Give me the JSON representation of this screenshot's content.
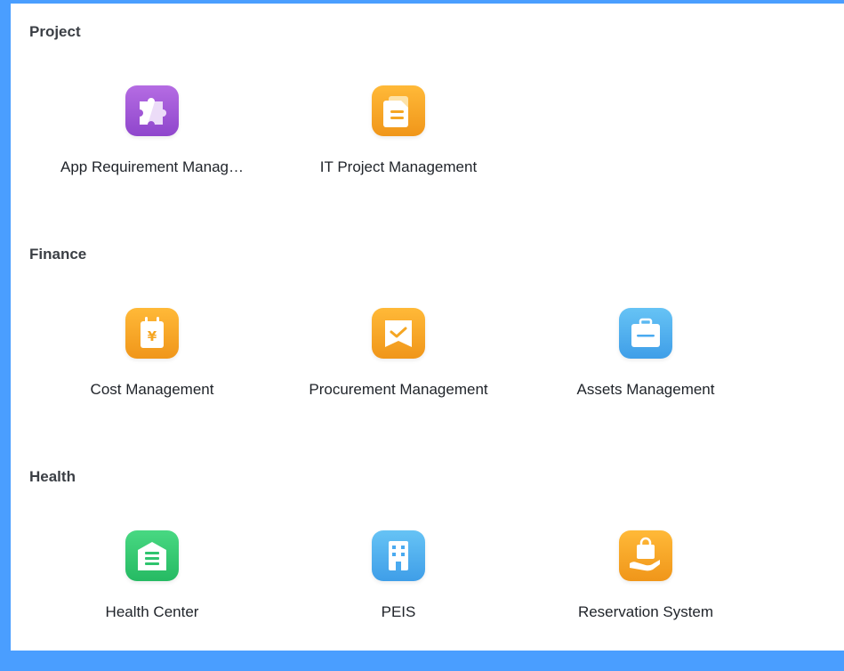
{
  "sections": [
    {
      "title": "Project",
      "apps": [
        {
          "label": "App Requirement Manag…",
          "icon": "puzzle-icon",
          "color": "#9b55d6"
        },
        {
          "label": "IT Project Management",
          "icon": "document-icon",
          "color": "#f5a623"
        }
      ]
    },
    {
      "title": "Finance",
      "apps": [
        {
          "label": "Cost Management",
          "icon": "yen-bag-icon",
          "color": "#f5a623"
        },
        {
          "label": "Procurement Management",
          "icon": "checked-envelope-icon",
          "color": "#f5a623"
        },
        {
          "label": "Assets Management",
          "icon": "briefcase-icon",
          "color": "#4aaaf0"
        }
      ]
    },
    {
      "title": "Health",
      "apps": [
        {
          "label": "Health Center",
          "icon": "building-list-icon",
          "color": "#2fc46e"
        },
        {
          "label": "PEIS",
          "icon": "office-building-icon",
          "color": "#4aaaf0"
        },
        {
          "label": "Reservation System",
          "icon": "hand-bag-icon",
          "color": "#f5a623"
        }
      ]
    }
  ]
}
